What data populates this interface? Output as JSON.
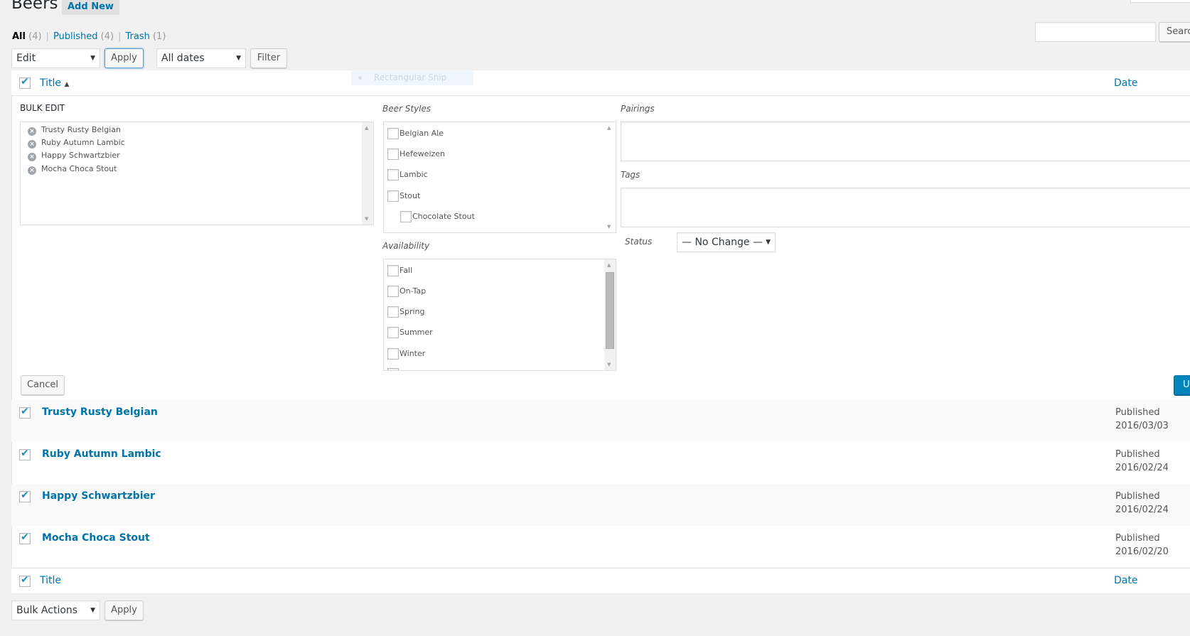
{
  "header": {
    "title": "Beers",
    "add_new_label": "Add New"
  },
  "views": [
    {
      "label": "All",
      "count": "(4)",
      "current": true
    },
    {
      "label": "Published",
      "count": "(4)",
      "current": false
    },
    {
      "label": "Trash",
      "count": "(1)",
      "current": false
    }
  ],
  "views_separator": "|",
  "top_actions": {
    "bulk_select_value": "Edit",
    "apply_label": "Apply",
    "dates_select_value": "All dates",
    "filter_label": "Filter"
  },
  "search": {
    "placeholder": "",
    "value": "",
    "button_label": "Search Beers"
  },
  "overlay": {
    "snip_label": "Rectangular Snip"
  },
  "table": {
    "columns": {
      "title": "Title",
      "sort_indicator": "▲",
      "date": "Date"
    },
    "header_checkbox_checked": true,
    "footer_checkbox_checked": true
  },
  "bulk_edit": {
    "heading": "BULK EDIT",
    "titles": [
      "Trusty Rusty Belgian",
      "Ruby Autumn Lambic",
      "Happy Schwartzbier",
      "Mocha Choca Stout"
    ],
    "remove_icon": "×",
    "beer_styles_label": "Beer Styles",
    "beer_styles": [
      {
        "label": "Belgian Ale",
        "checked": false,
        "child": false
      },
      {
        "label": "Hefeweizen",
        "checked": false,
        "child": false
      },
      {
        "label": "Lambic",
        "checked": false,
        "child": false
      },
      {
        "label": "Stout",
        "checked": false,
        "child": false
      },
      {
        "label": "Chocolate Stout",
        "checked": false,
        "child": true
      }
    ],
    "availability_label": "Availability",
    "availability": [
      {
        "label": "Fall",
        "checked": false
      },
      {
        "label": "On-Tap",
        "checked": false
      },
      {
        "label": "Spring",
        "checked": false
      },
      {
        "label": "Summer",
        "checked": false
      },
      {
        "label": "Winter",
        "checked": false
      }
    ],
    "pairings_label": "Pairings",
    "pairings_value": "",
    "tags_label": "Tags",
    "tags_value": "",
    "status_label": "Status",
    "status_value": "— No Change —",
    "cancel_label": "Cancel",
    "update_label": "Update"
  },
  "rows": [
    {
      "title": "Trusty Rusty Belgian",
      "status": "Published",
      "date": "2016/03/03",
      "checked": true
    },
    {
      "title": "Ruby Autumn Lambic",
      "status": "Published",
      "date": "2016/02/24",
      "checked": true
    },
    {
      "title": "Happy Schwartzbier",
      "status": "Published",
      "date": "2016/02/24",
      "checked": true
    },
    {
      "title": "Mocha Choca Stout",
      "status": "Published",
      "date": "2016/02/20",
      "checked": true
    }
  ],
  "bottom_actions": {
    "bulk_select_value": "Bulk Actions",
    "apply_label": "Apply"
  },
  "icons": {
    "select_arrow": "▼",
    "scroll_up": "▲",
    "scroll_down": "▼"
  },
  "colors": {
    "link": "#0073aa",
    "primary_button": "#0085ba",
    "checkmark": "#1e8cbe",
    "background": "#f1f1f1"
  }
}
